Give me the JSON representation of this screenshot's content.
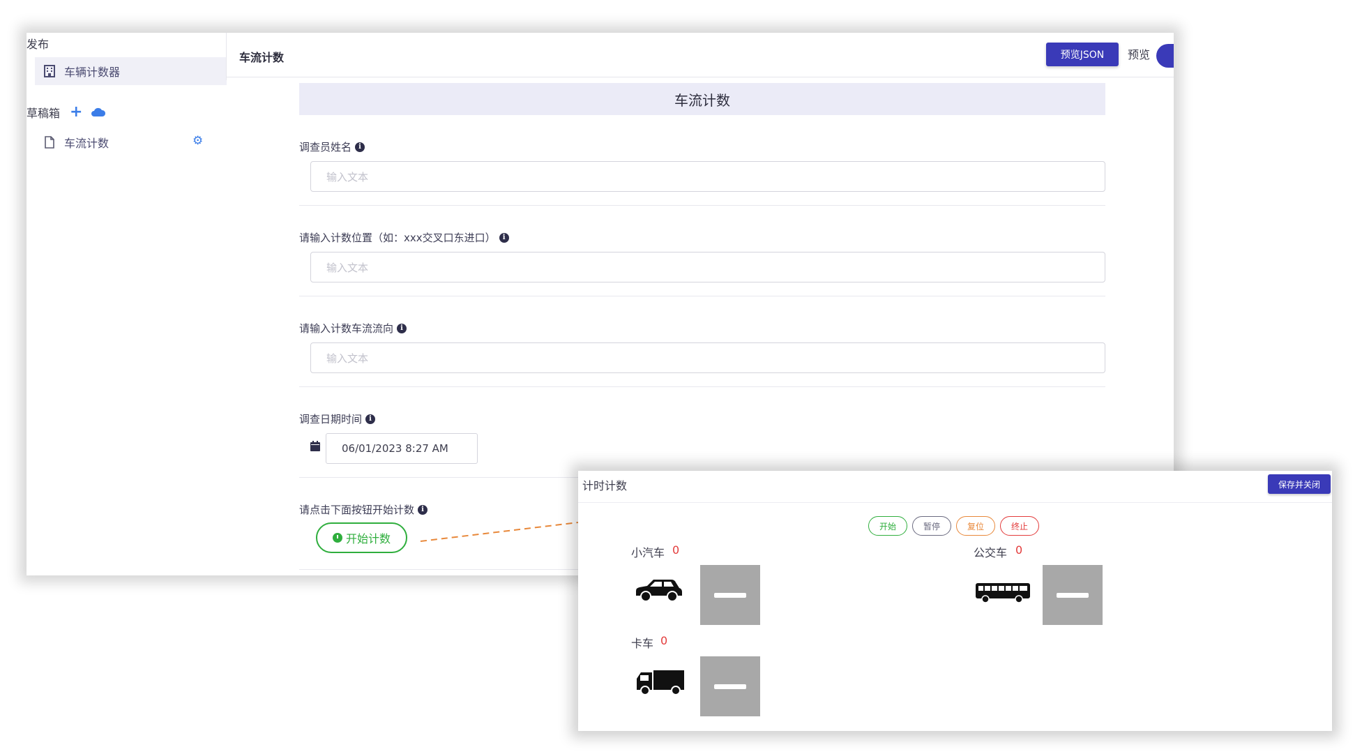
{
  "sidebar": {
    "publish_label": "发布",
    "published_item": "车辆计数器",
    "drafts_label": "草稿箱",
    "draft_item": "车流计数"
  },
  "topbar": {
    "title": "车流计数",
    "preview_json_label": "预览JSON",
    "preview_label": "预览",
    "preview_enabled": true
  },
  "form": {
    "header": "车流计数",
    "fields": [
      {
        "label": "调查员姓名",
        "placeholder": "输入文本"
      },
      {
        "label": "请输入计数位置（如：xxx交叉口东进口）",
        "placeholder": "输入文本"
      },
      {
        "label": "请输入计数车流流向",
        "placeholder": "输入文本"
      }
    ],
    "datetime": {
      "label": "调查日期时间",
      "value": "06/01/2023 8:27 AM"
    },
    "start": {
      "label": "请点击下面按钮开始计数",
      "button": "开始计数"
    }
  },
  "counter": {
    "title": "计时计数",
    "save_label": "保存并关闭",
    "controls": [
      {
        "label": "开始",
        "color": "#2fae3d"
      },
      {
        "label": "暂停",
        "color": "#6b6b80"
      },
      {
        "label": "复位",
        "color": "#e8883a"
      },
      {
        "label": "终止",
        "color": "#e33b3b"
      }
    ],
    "vehicles": [
      {
        "label": "小汽车",
        "count": "0"
      },
      {
        "label": "公交车",
        "count": "0"
      },
      {
        "label": "卡车",
        "count": "0"
      }
    ]
  },
  "colors": {
    "accent": "#3a3ab8",
    "link_blue": "#3b7de8",
    "success": "#2fae3d",
    "danger": "#e33b3b",
    "connector": "#e8883a"
  }
}
